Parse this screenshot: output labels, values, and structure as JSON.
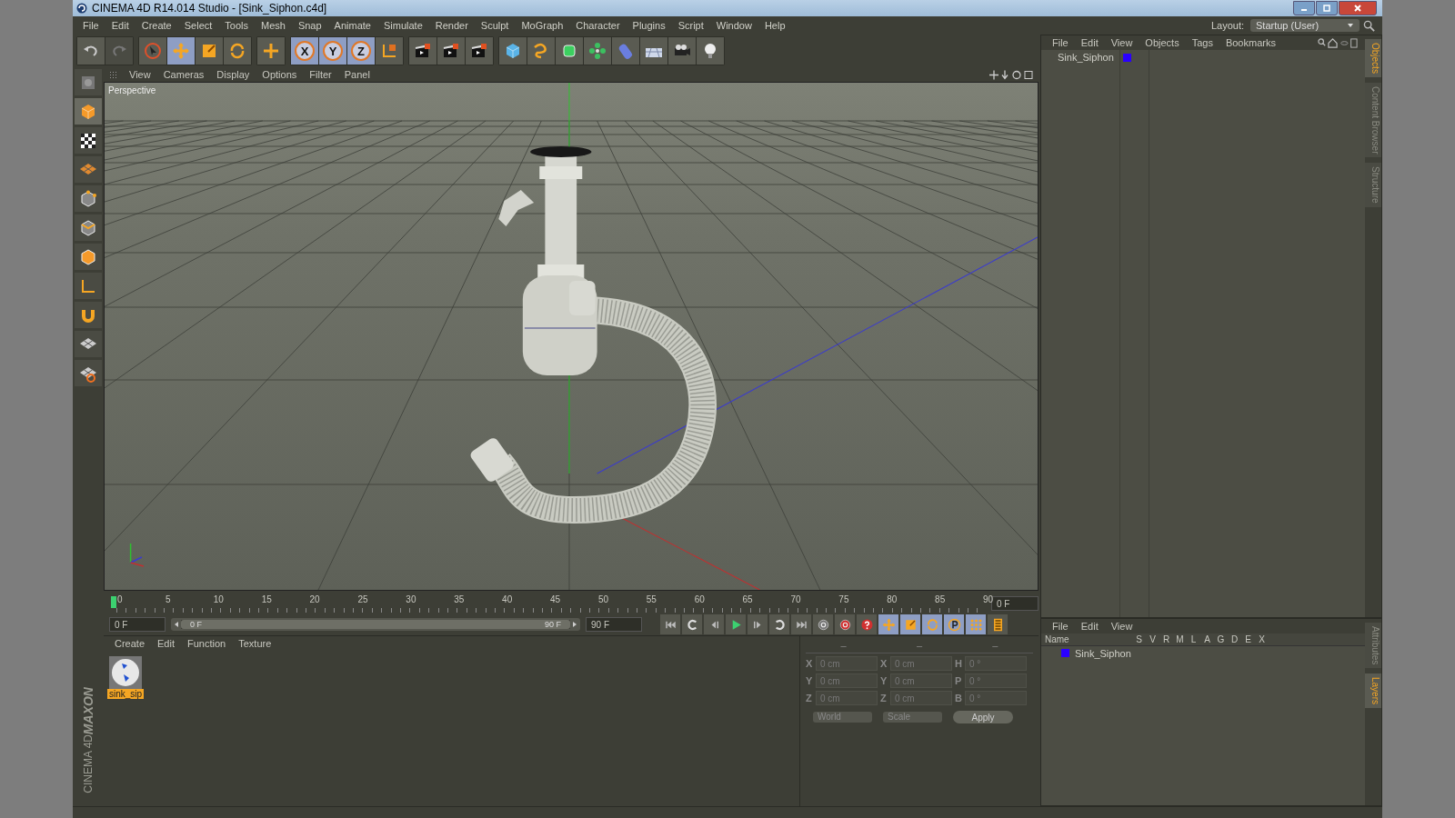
{
  "window": {
    "title": "CINEMA 4D R14.014 Studio - [Sink_Siphon.c4d]"
  },
  "menu_bar": [
    "File",
    "Edit",
    "Create",
    "Select",
    "Tools",
    "Mesh",
    "Snap",
    "Animate",
    "Simulate",
    "Render",
    "Sculpt",
    "MoGraph",
    "Character",
    "Plugins",
    "Script",
    "Window",
    "Help"
  ],
  "layout": {
    "label": "Layout:",
    "value": "Startup (User)"
  },
  "toolbar": [
    [
      {
        "kind": "undo",
        "disabled": false
      },
      {
        "kind": "redo",
        "disabled": true
      }
    ],
    [
      {
        "kind": "live-select",
        "selected": false
      },
      {
        "kind": "move",
        "selected": true
      },
      {
        "kind": "scale",
        "selected": false
      },
      {
        "kind": "rotate",
        "selected": false
      }
    ],
    [
      {
        "kind": "plus",
        "selected": false
      }
    ],
    [
      {
        "kind": "axis-lock",
        "label": "X",
        "selected": true
      },
      {
        "kind": "axis-lock",
        "label": "Y",
        "selected": true
      },
      {
        "kind": "axis-lock",
        "label": "Z",
        "selected": true
      },
      {
        "kind": "world-axes",
        "selected": false
      }
    ],
    [
      {
        "kind": "render",
        "selected": false
      },
      {
        "kind": "render",
        "selected": false
      },
      {
        "kind": "render",
        "selected": false
      }
    ],
    [
      {
        "kind": "cube",
        "selected": false
      },
      {
        "kind": "spline",
        "selected": false
      },
      {
        "kind": "subdivision",
        "selected": false
      },
      {
        "kind": "cloner",
        "selected": false
      },
      {
        "kind": "deformer",
        "selected": false
      },
      {
        "kind": "floor",
        "selected": false
      },
      {
        "kind": "camera",
        "selected": false
      },
      {
        "kind": "light",
        "selected": false
      }
    ]
  ],
  "left_toolbar": [
    {
      "kind": "editable",
      "selected": false
    },
    {
      "kind": "model",
      "selected": true
    },
    {
      "kind": "texture",
      "selected": false
    },
    {
      "kind": "workplane",
      "selected": false
    },
    {
      "kind": "points",
      "selected": false
    },
    {
      "kind": "edges",
      "selected": false
    },
    {
      "kind": "polygons",
      "selected": false
    },
    {
      "kind": "axis",
      "selected": false
    },
    {
      "kind": "magnet",
      "selected": false
    },
    {
      "kind": "grid",
      "selected": false
    },
    {
      "kind": "grid-lock",
      "selected": false
    }
  ],
  "viewport": {
    "menu": [
      "View",
      "Cameras",
      "Display",
      "Options",
      "Filter",
      "Panel"
    ],
    "camera": "Perspective"
  },
  "timeline": {
    "ticks": [
      "0",
      "5",
      "10",
      "15",
      "20",
      "25",
      "30",
      "35",
      "40",
      "45",
      "50",
      "55",
      "60",
      "65",
      "70",
      "75",
      "80",
      "85",
      "90"
    ],
    "level": 0,
    "current_frame": "0 F",
    "start": "0 F",
    "range": {
      "start": "0 F",
      "end": "90 F",
      "level": 1
    },
    "end": "90 F",
    "controls": [
      {
        "kind": "first",
        "selected": false
      },
      {
        "kind": "prev-key",
        "selected": false
      },
      {
        "kind": "prev-frame",
        "selected": false
      },
      {
        "kind": "play",
        "selected": false
      },
      {
        "kind": "next-frame",
        "selected": false
      },
      {
        "kind": "next-key",
        "selected": false
      },
      {
        "kind": "last",
        "selected": false
      },
      {
        "kind": "record-keys",
        "selected": false
      },
      {
        "kind": "auto-key",
        "selected": false
      },
      {
        "kind": "key-help",
        "selected": false
      },
      {
        "kind": "key-move",
        "selected": true
      },
      {
        "kind": "key-scale",
        "selected": true
      },
      {
        "kind": "key-rotate",
        "selected": true
      },
      {
        "kind": "key-param",
        "selected": true
      },
      {
        "kind": "key-points",
        "selected": true
      },
      {
        "kind": "timeline",
        "selected": false
      }
    ]
  },
  "material_manager": {
    "menu": [
      "Create",
      "Edit",
      "Function",
      "Texture"
    ],
    "materials": [
      {
        "name": "sink_sip",
        "selected": true
      }
    ]
  },
  "coordinates": {
    "headers": [
      "–",
      "–",
      "–"
    ],
    "rows": [
      {
        "axis": "X",
        "position": "0 cm",
        "size_axis": "X",
        "size": "0 cm",
        "rotation_axis": "H",
        "rotation": "0 °"
      },
      {
        "axis": "Y",
        "position": "0 cm",
        "size_axis": "Y",
        "size": "0 cm",
        "rotation_axis": "P",
        "rotation": "0 °"
      },
      {
        "axis": "Z",
        "position": "0 cm",
        "size_axis": "Z",
        "size": "0 cm",
        "rotation_axis": "B",
        "rotation": "0 °"
      }
    ],
    "mode": "World",
    "size_mode": "Scale",
    "apply": "Apply"
  },
  "objects_manager": {
    "menu": [
      "File",
      "Edit",
      "View",
      "Objects",
      "Tags",
      "Bookmarks"
    ],
    "objects": [
      {
        "name": "Sink_Siphon",
        "color": "#2a00ff"
      }
    ],
    "side_tabs": [
      {
        "label": "Objects",
        "selected": true
      },
      {
        "label": "Content Browser",
        "selected": false
      },
      {
        "label": "Structure",
        "selected": false
      }
    ]
  },
  "layer_manager": {
    "menu": [
      "File",
      "Edit",
      "View"
    ],
    "columns": [
      "Name",
      "S",
      "V",
      "R",
      "M",
      "L",
      "A",
      "G",
      "D",
      "E",
      "X"
    ],
    "layers": [
      {
        "name": "Sink_Siphon",
        "color": "#2a00ff"
      }
    ],
    "side_tabs": [
      {
        "label": "Attributes",
        "selected": false
      },
      {
        "label": "Layers",
        "selected": true
      }
    ]
  },
  "logo": {
    "brand": "MAXON",
    "product": "CINEMA 4D"
  }
}
